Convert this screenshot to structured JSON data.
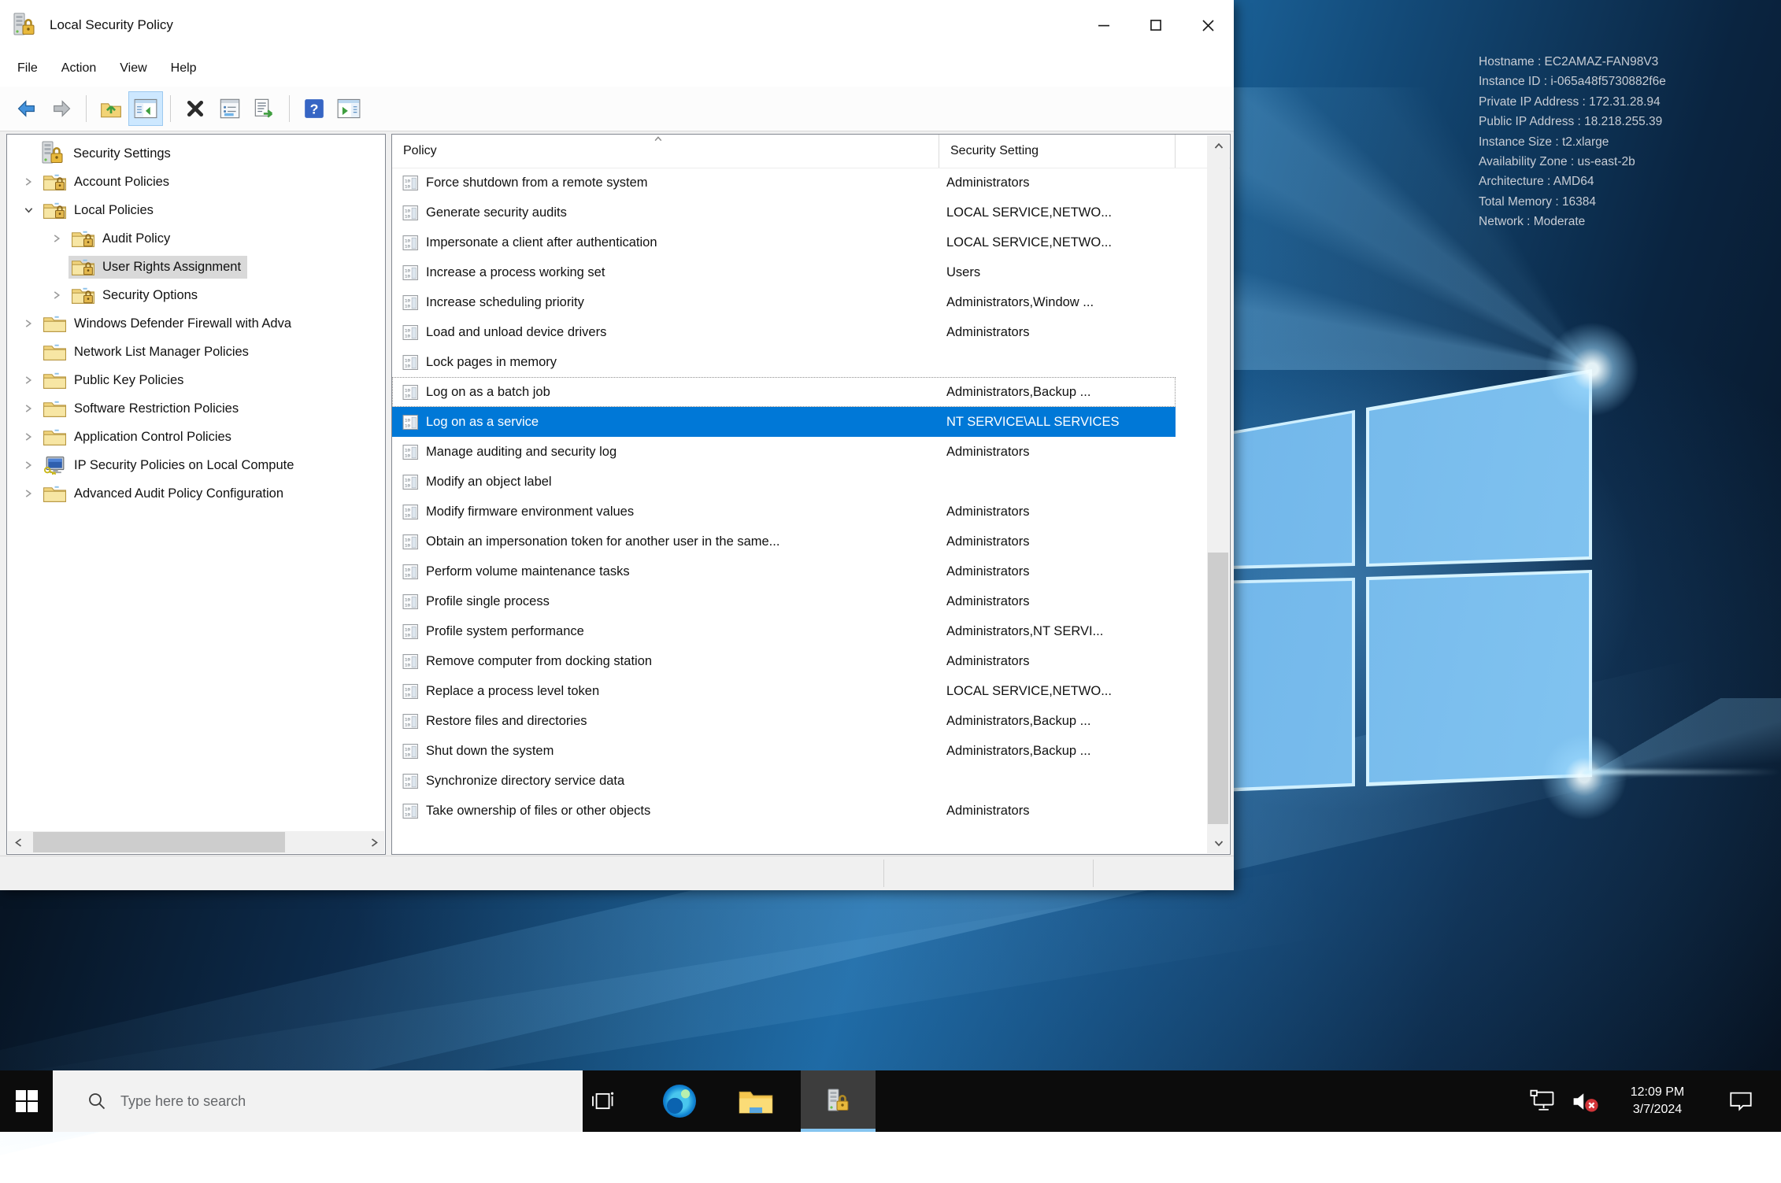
{
  "colors": {
    "accent": "#0078d7",
    "tree_selection": "#d9d9d9",
    "taskbar": "#0c0c0c",
    "active_app_underline": "#86c5f0",
    "wallpaper_navy": "#0d2c4d",
    "mute_badge_red": "#d13438"
  },
  "window": {
    "title": "Local Security Policy",
    "menu": [
      "File",
      "Action",
      "View",
      "Help"
    ],
    "controls": {
      "minimize": "minimize",
      "maximize": "maximize",
      "close": "close"
    },
    "toolbar": {
      "items": [
        {
          "icon": "back-arrow",
          "name": "back-button"
        },
        {
          "icon": "forward-arrow",
          "name": "forward-button"
        },
        {
          "sep": true
        },
        {
          "icon": "up-folder",
          "name": "up-one-level-button"
        },
        {
          "icon": "console-tree",
          "name": "show-console-tree-button",
          "highlighted": true
        },
        {
          "sep": true
        },
        {
          "icon": "delete-x",
          "name": "delete-button"
        },
        {
          "icon": "properties",
          "name": "properties-button"
        },
        {
          "icon": "export-list",
          "name": "export-list-button"
        },
        {
          "sep": true
        },
        {
          "icon": "help",
          "name": "help-button"
        },
        {
          "icon": "action-pane",
          "name": "show-action-pane-button"
        }
      ]
    },
    "tree": {
      "items": [
        {
          "label": "Security Settings",
          "depth": 0,
          "chevron": "none",
          "icon": "secpol"
        },
        {
          "label": "Account Policies",
          "depth": 1,
          "chevron": "collapsed",
          "icon": "folder-lock"
        },
        {
          "label": "Local Policies",
          "depth": 1,
          "chevron": "expanded",
          "icon": "folder-lock"
        },
        {
          "label": "Audit Policy",
          "depth": 2,
          "chevron": "collapsed",
          "icon": "folder-lock"
        },
        {
          "label": "User Rights Assignment",
          "depth": 2,
          "chevron": "none",
          "icon": "folder-lock",
          "selected": true
        },
        {
          "label": "Security Options",
          "depth": 2,
          "chevron": "collapsed",
          "icon": "folder-lock"
        },
        {
          "label": "Windows Defender Firewall with Adva",
          "depth": 1,
          "chevron": "collapsed",
          "icon": "folder"
        },
        {
          "label": "Network List Manager Policies",
          "depth": 1,
          "chevron": "none",
          "icon": "folder"
        },
        {
          "label": "Public Key Policies",
          "depth": 1,
          "chevron": "collapsed",
          "icon": "folder"
        },
        {
          "label": "Software Restriction Policies",
          "depth": 1,
          "chevron": "collapsed",
          "icon": "folder"
        },
        {
          "label": "Application Control Policies",
          "depth": 1,
          "chevron": "collapsed",
          "icon": "folder"
        },
        {
          "label": "IP Security Policies on Local Compute",
          "depth": 1,
          "chevron": "collapsed",
          "icon": "ipsec"
        },
        {
          "label": "Advanced Audit Policy Configuration",
          "depth": 1,
          "chevron": "collapsed",
          "icon": "folder"
        }
      ]
    },
    "list": {
      "columns": [
        "Policy",
        "Security Setting"
      ],
      "rows": [
        {
          "policy": "Force shutdown from a remote system",
          "setting": "Administrators"
        },
        {
          "policy": "Generate security audits",
          "setting": "LOCAL SERVICE,NETWO..."
        },
        {
          "policy": "Impersonate a client after authentication",
          "setting": "LOCAL SERVICE,NETWO..."
        },
        {
          "policy": "Increase a process working set",
          "setting": "Users"
        },
        {
          "policy": "Increase scheduling priority",
          "setting": "Administrators,Window ..."
        },
        {
          "policy": "Load and unload device drivers",
          "setting": "Administrators"
        },
        {
          "policy": "Lock pages in memory",
          "setting": ""
        },
        {
          "policy": "Log on as a batch job",
          "setting": "Administrators,Backup ...",
          "state": "focused"
        },
        {
          "policy": "Log on as a service",
          "setting": "NT SERVICE\\ALL SERVICES",
          "state": "selected"
        },
        {
          "policy": "Manage auditing and security log",
          "setting": "Administrators"
        },
        {
          "policy": "Modify an object label",
          "setting": ""
        },
        {
          "policy": "Modify firmware environment values",
          "setting": "Administrators"
        },
        {
          "policy": "Obtain an impersonation token for another user in the same...",
          "setting": "Administrators"
        },
        {
          "policy": "Perform volume maintenance tasks",
          "setting": "Administrators"
        },
        {
          "policy": "Profile single process",
          "setting": "Administrators"
        },
        {
          "policy": "Profile system performance",
          "setting": "Administrators,NT SERVI..."
        },
        {
          "policy": "Remove computer from docking station",
          "setting": "Administrators"
        },
        {
          "policy": "Replace a process level token",
          "setting": "LOCAL SERVICE,NETWO..."
        },
        {
          "policy": "Restore files and directories",
          "setting": "Administrators,Backup ..."
        },
        {
          "policy": "Shut down the system",
          "setting": "Administrators,Backup ..."
        },
        {
          "policy": "Synchronize directory service data",
          "setting": ""
        },
        {
          "policy": "Take ownership of files or other objects",
          "setting": "Administrators"
        }
      ]
    }
  },
  "desktop": {
    "info_lines": [
      "Hostname : EC2AMAZ-FAN98V3",
      "Instance ID : i-065a48f5730882f6e",
      "Private IP Address : 172.31.28.94",
      "Public IP Address : 18.218.255.39",
      "Instance Size : t2.xlarge",
      "Availability Zone : us-east-2b",
      "Architecture : AMD64",
      "Total Memory : 16384",
      "Network : Moderate"
    ]
  },
  "taskbar": {
    "search_placeholder": "Type here to search",
    "clock": {
      "time": "12:09 PM",
      "date": "3/7/2024"
    }
  }
}
